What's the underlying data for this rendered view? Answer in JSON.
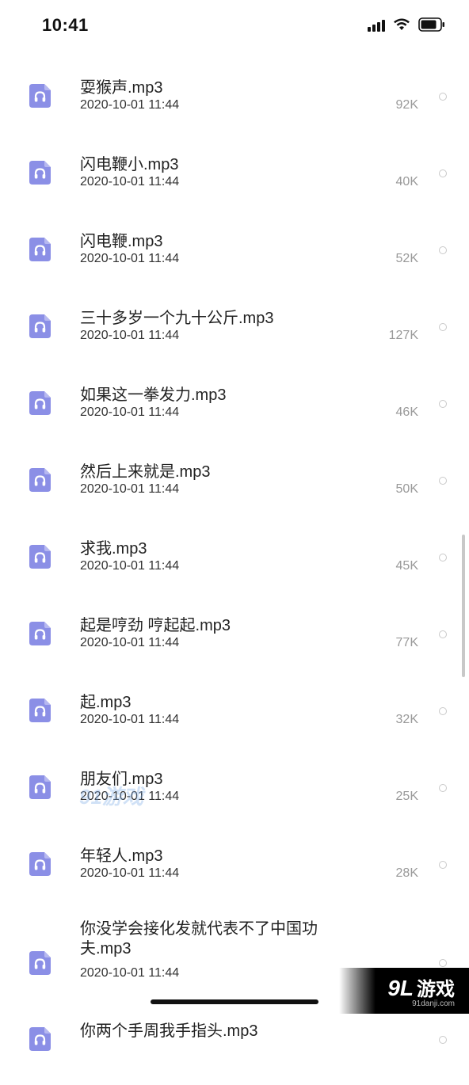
{
  "status_bar": {
    "time": "10:41"
  },
  "files": [
    {
      "name": "耍猴声.mp3",
      "date": "2020-10-01 11:44",
      "size": "92K"
    },
    {
      "name": "闪电鞭小.mp3",
      "date": "2020-10-01 11:44",
      "size": "40K"
    },
    {
      "name": "闪电鞭.mp3",
      "date": "2020-10-01 11:44",
      "size": "52K"
    },
    {
      "name": "三十多岁一个九十公斤.mp3",
      "date": "2020-10-01 11:44",
      "size": "127K"
    },
    {
      "name": "如果这一拳发力.mp3",
      "date": "2020-10-01 11:44",
      "size": "46K"
    },
    {
      "name": "然后上来就是.mp3",
      "date": "2020-10-01 11:44",
      "size": "50K"
    },
    {
      "name": "求我.mp3",
      "date": "2020-10-01 11:44",
      "size": "45K"
    },
    {
      "name": "起是哼劲 哼起起.mp3",
      "date": "2020-10-01 11:44",
      "size": "77K"
    },
    {
      "name": "起.mp3",
      "date": "2020-10-01 11:44",
      "size": "32K"
    },
    {
      "name": "朋友们.mp3",
      "date": "2020-10-01 11:44",
      "size": "25K"
    },
    {
      "name": "年轻人.mp3",
      "date": "2020-10-01 11:44",
      "size": "28K"
    },
    {
      "name": "你没学会接化发就代表不了中国功夫.mp3",
      "date": "2020-10-01 11:44",
      "size": ""
    },
    {
      "name": "你两个手周我手指头.mp3",
      "date": "",
      "size": ""
    }
  ],
  "watermark": {
    "logo_num": "9L",
    "logo_text": "游戏",
    "url": "91danji.com"
  },
  "colors": {
    "icon_bg": "#8b8fe6",
    "icon_fg": "#ffffff",
    "size_text": "#999999"
  },
  "icons": {
    "file_icon": "headphones-file-icon"
  }
}
